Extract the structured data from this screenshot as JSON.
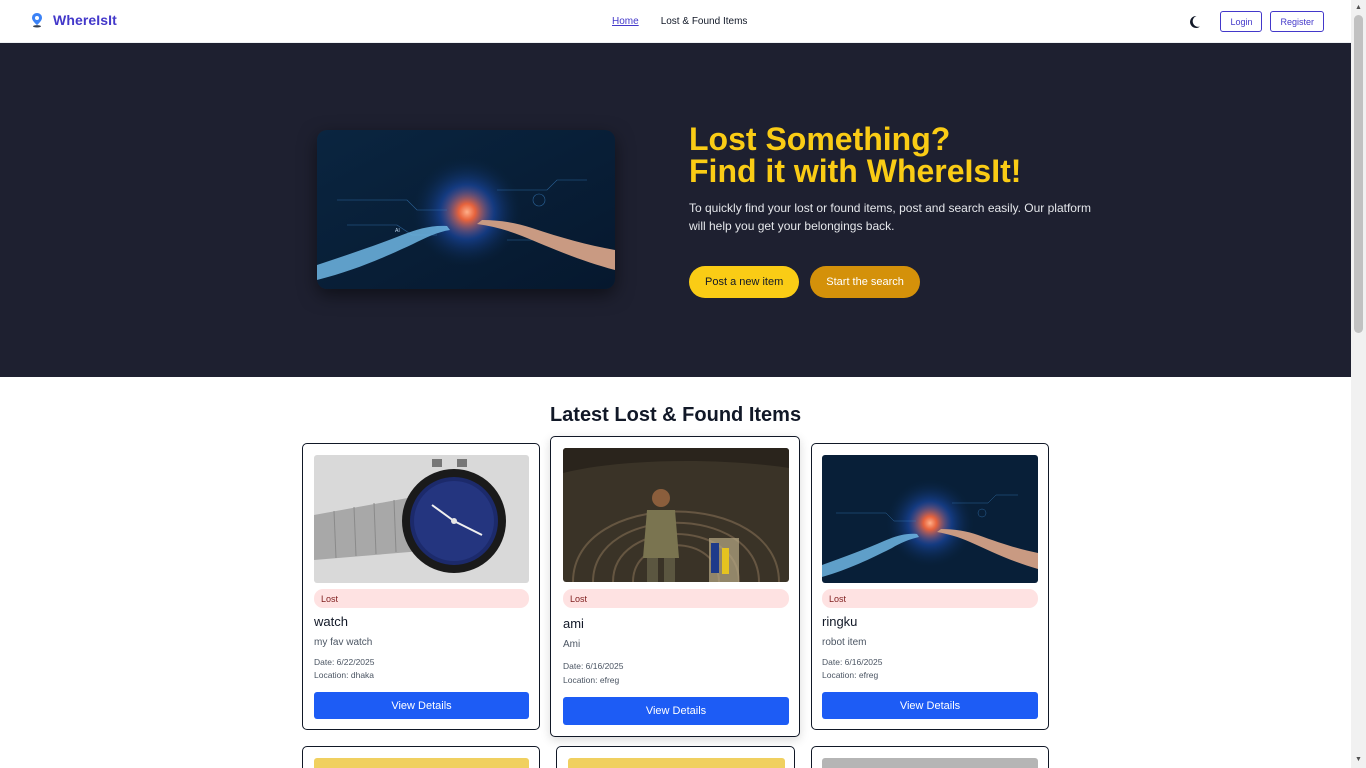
{
  "brand": {
    "name": "WhereIsIt"
  },
  "nav": {
    "home": "Home",
    "items": "Lost & Found Items"
  },
  "auth": {
    "login": "Login",
    "register": "Register"
  },
  "hero": {
    "title_line1": "Lost Something?",
    "title_line2": "Find it with WhereIsIt!",
    "description": "To quickly find your lost or found items, post and search easily. Our platform will help you get your belongings back.",
    "btn_post": "Post a new item",
    "btn_search": "Start the search"
  },
  "section": {
    "title": "Latest Lost & Found Items"
  },
  "cards": [
    {
      "badge": "Lost",
      "title": "watch",
      "desc": "my fav watch",
      "date": "Date: 6/22/2025",
      "location": "Location: dhaka",
      "button": "View Details"
    },
    {
      "badge": "Lost",
      "title": "ami",
      "desc": "Ami",
      "date": "Date: 6/16/2025",
      "location": "Location: efreg",
      "button": "View Details"
    },
    {
      "badge": "Lost",
      "title": "ringku",
      "desc": "robot item",
      "date": "Date: 6/16/2025",
      "location": "Location: efreg",
      "button": "View Details"
    }
  ],
  "colors": {
    "brand": "#4338ca",
    "hero_bg": "#1e2030",
    "hero_title": "#facc15",
    "primary_button": "#1d5cf5",
    "lost_badge_bg": "#fee2e2"
  }
}
